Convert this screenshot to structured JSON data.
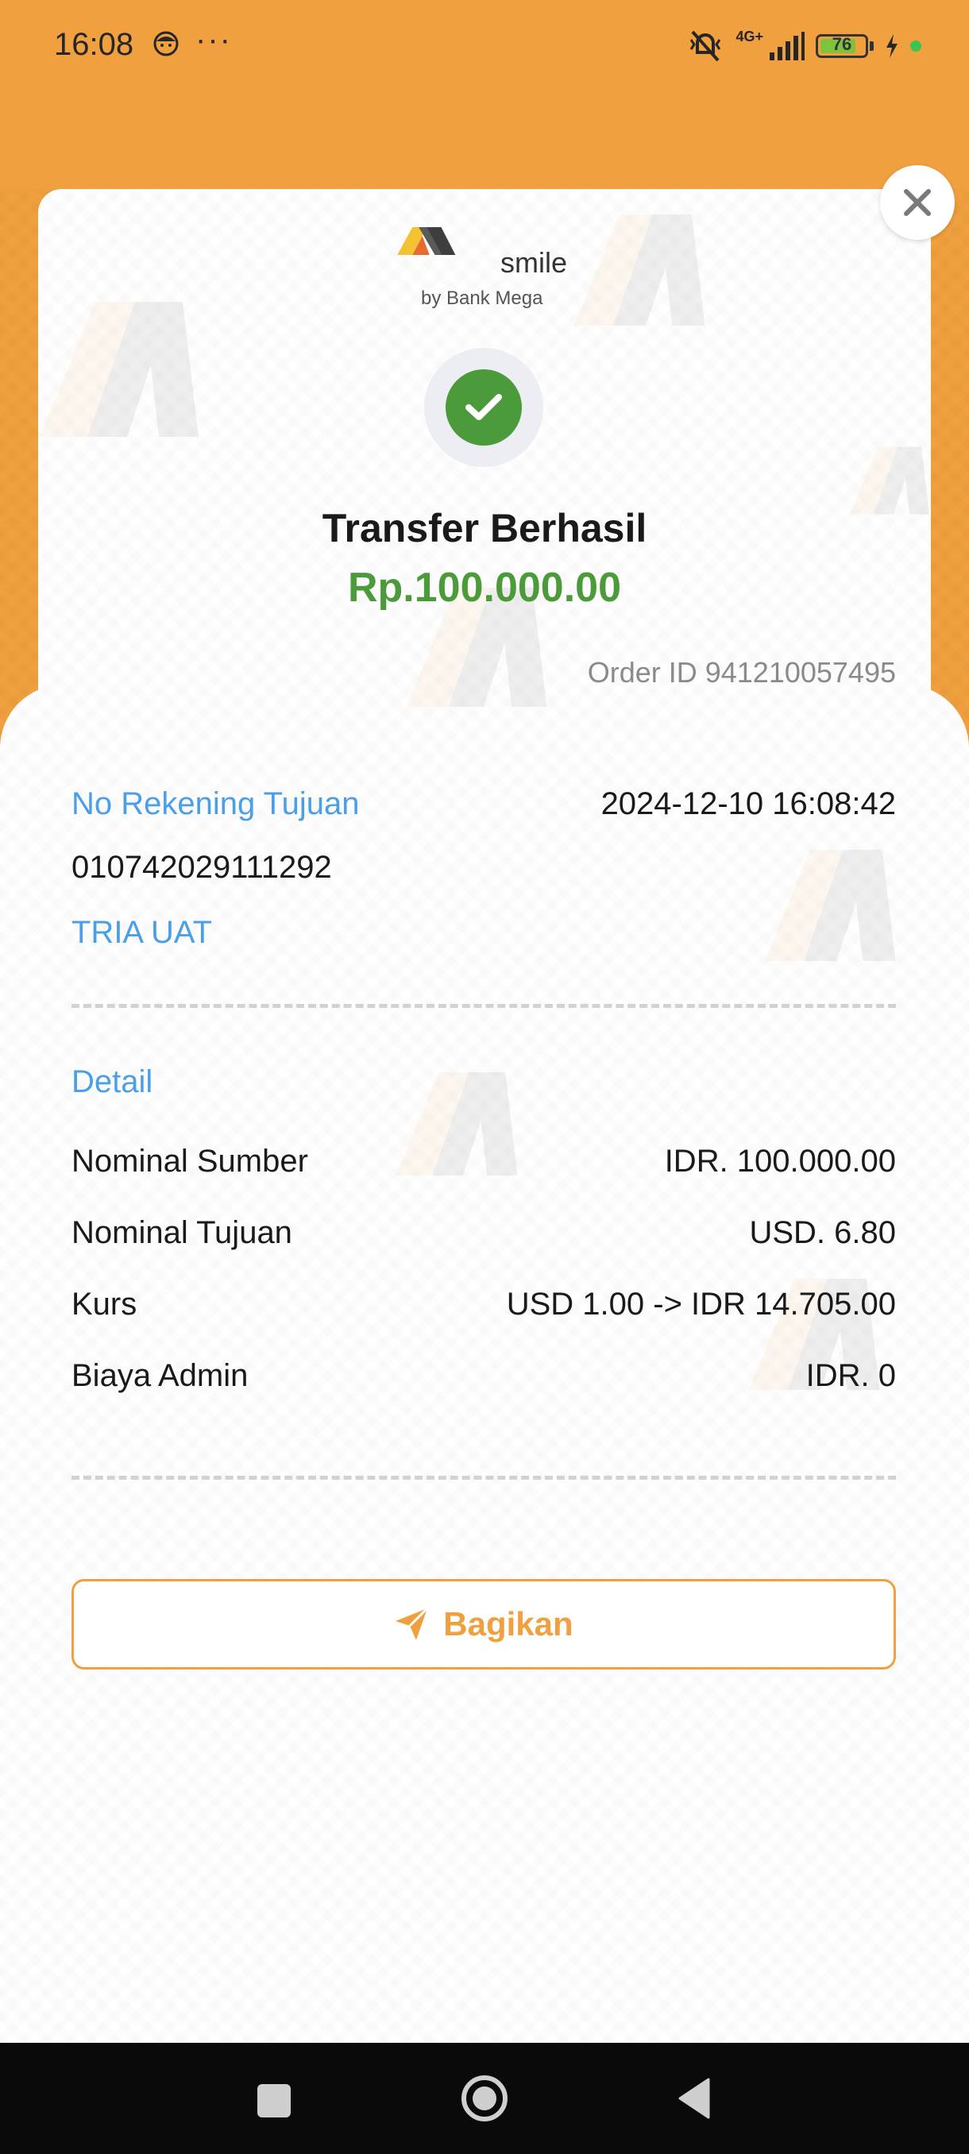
{
  "status_bar": {
    "time": "16:08",
    "more": "···",
    "network": "4G+",
    "battery": "76"
  },
  "receipt": {
    "brand_name": "smile",
    "brand_by": "by Bank Mega",
    "title": "Transfer Berhasil",
    "amount": "Rp.100.000.00",
    "order_id": "Order ID 941210057495"
  },
  "destination": {
    "label": "No Rekening Tujuan",
    "datetime": "2024-12-10 16:08:42",
    "account_number": "010742029111292",
    "account_name": "TRIA UAT"
  },
  "detail": {
    "heading": "Detail",
    "rows": [
      {
        "key": "Nominal Sumber",
        "value": "IDR. 100.000.00"
      },
      {
        "key": "Nominal Tujuan",
        "value": "USD. 6.80"
      },
      {
        "key": "Kurs",
        "value": "USD 1.00 -> IDR 14.705.00"
      },
      {
        "key": "Biaya Admin",
        "value": "IDR. 0"
      }
    ]
  },
  "actions": {
    "share_label": "Bagikan"
  },
  "colors": {
    "accent": "#F0A03E",
    "success": "#4C9B3A",
    "link_blue": "#4A9FE8"
  }
}
